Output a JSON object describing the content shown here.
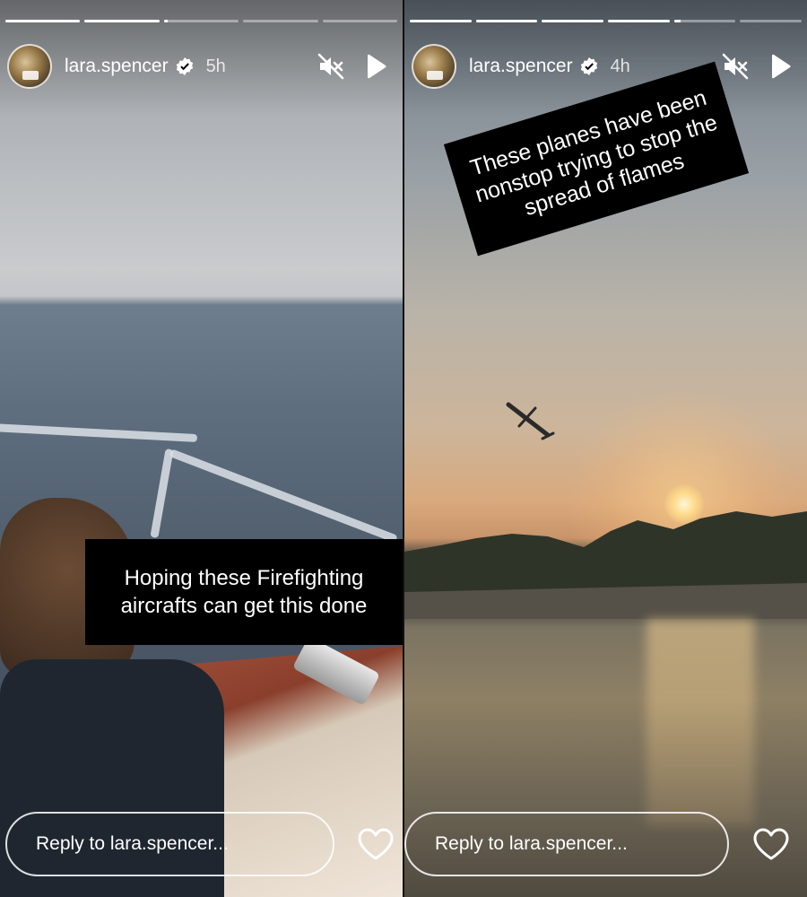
{
  "stories": [
    {
      "username": "lara.spencer",
      "time": "5h",
      "caption": "Hoping these Firefighting aircrafts can get this done",
      "reply_placeholder": "Reply to lara.spencer...",
      "progress": [
        1,
        1,
        0.05,
        0,
        0
      ]
    },
    {
      "username": "lara.spencer",
      "time": "4h",
      "caption": "These planes have been nonstop trying to stop the spread of flames",
      "reply_placeholder": "Reply to lara.spencer...",
      "progress": [
        1,
        1,
        1,
        1,
        0.1,
        0
      ]
    }
  ],
  "icons": {
    "verified": "verified-badge-icon",
    "mute": "speaker-muted-icon",
    "play": "play-icon",
    "like": "heart-outline-icon"
  },
  "colors": {
    "caption_bg": "#000000",
    "text": "#ffffff"
  }
}
